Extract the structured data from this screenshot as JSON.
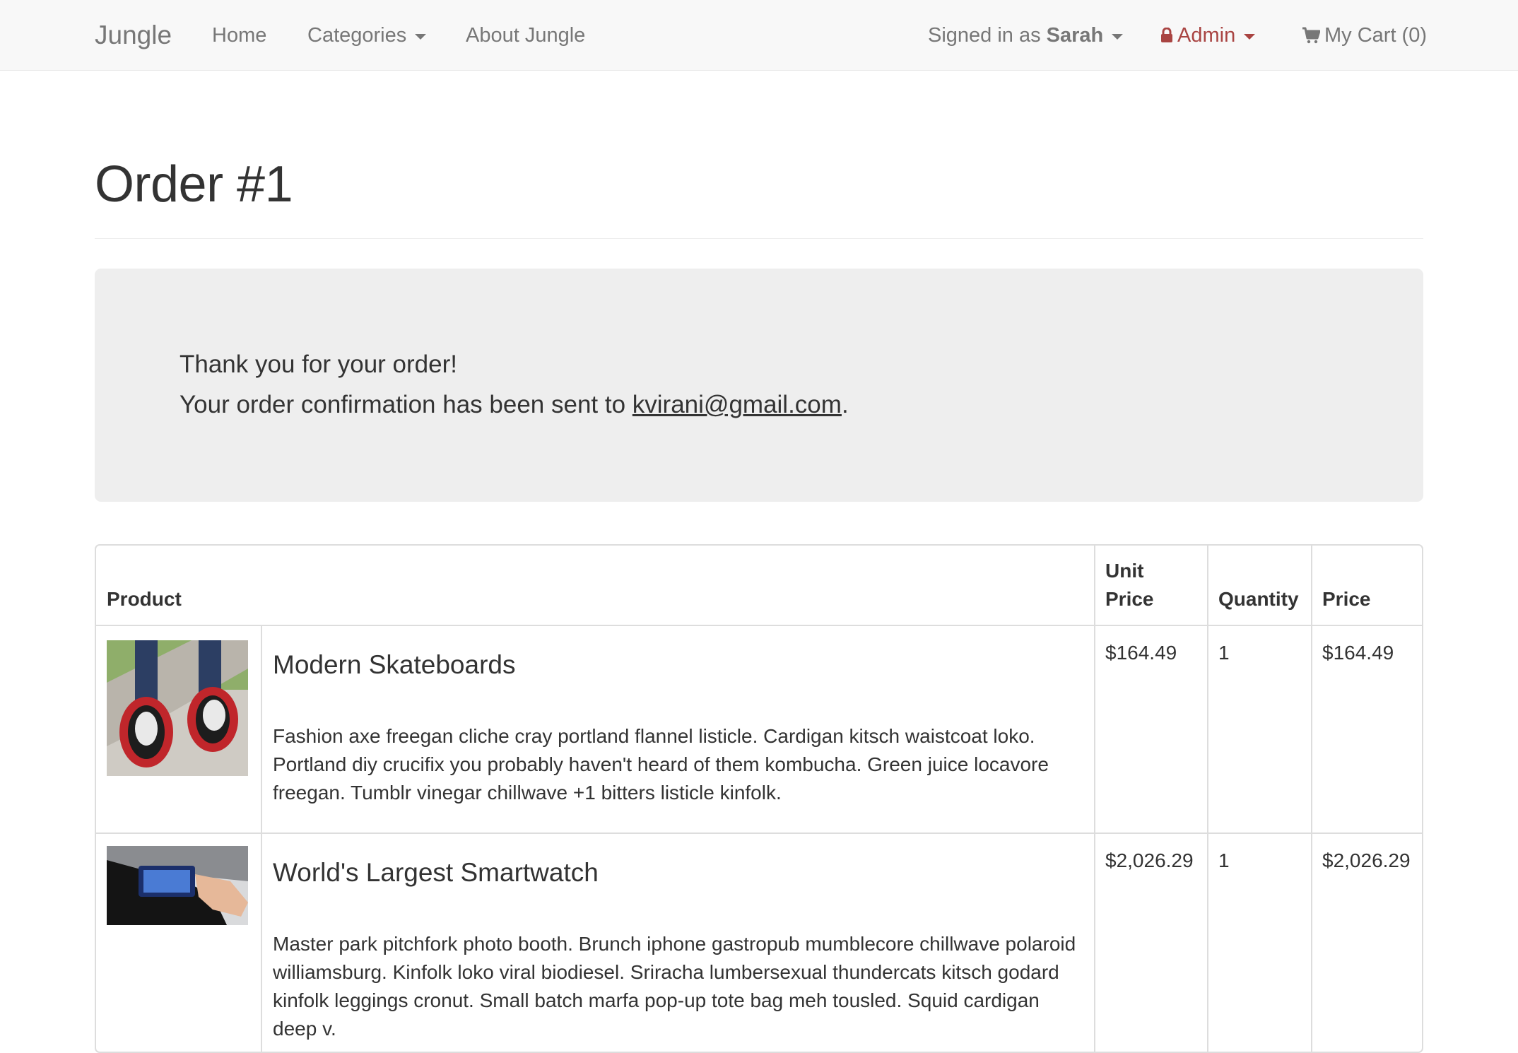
{
  "navbar": {
    "brand": "Jungle",
    "home": "Home",
    "categories": "Categories",
    "about": "About Jungle",
    "signed_in_prefix": "Signed in as",
    "user_name": "Sarah",
    "admin": "Admin",
    "cart": "My Cart (0)"
  },
  "page": {
    "title": "Order #1"
  },
  "confirmation": {
    "thanks": "Thank you for your order!",
    "sent_prefix": "Your order confirmation has been sent to ",
    "email": "kvirani@gmail.com",
    "sent_suffix": "."
  },
  "table": {
    "headers": {
      "product": "Product",
      "unit_price_line1": "Unit",
      "unit_price_line2": "Price",
      "quantity": "Quantity",
      "price": "Price"
    },
    "rows": [
      {
        "name": "Modern Skateboards",
        "description": "Fashion axe freegan cliche cray portland flannel listicle. Cardigan kitsch waistcoat loko. Portland diy crucifix you probably haven't heard of them kombucha. Green juice locavore freegan. Tumblr vinegar chillwave +1 bitters listicle kinfolk.",
        "unit_price": "$164.49",
        "quantity": "1",
        "price": "$164.49",
        "image_icon": "skate-wheels-photo"
      },
      {
        "name": "World's Largest Smartwatch",
        "description": "Master park pitchfork photo booth. Brunch iphone gastropub mumblecore chillwave polaroid williamsburg. Kinfolk loko viral biodiesel. Sriracha lumbersexual thundercats kitsch godard kinfolk leggings cronut. Small batch marfa pop-up tote bag meh tousled. Squid cardigan deep v.",
        "unit_price": "$2,026.29",
        "quantity": "1",
        "price": "$2,026.29",
        "image_icon": "smartwatch-photo"
      }
    ]
  },
  "colors": {
    "navbar_bg": "#f8f8f8",
    "nav_text": "#777777",
    "admin_text": "#a94442",
    "jumbotron_bg": "#eeeeee",
    "table_border": "#dddddd",
    "text": "#333333"
  }
}
